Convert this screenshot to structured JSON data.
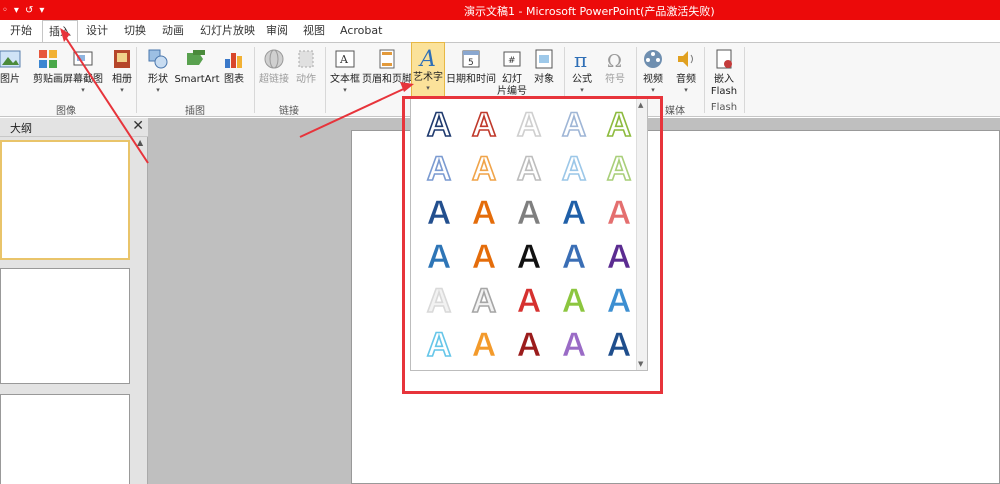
{
  "window": {
    "title": "演示文稿1 - Microsoft PowerPoint(产品激活失败)",
    "qat_items": [
      "◦",
      "▾",
      "↺",
      "▾"
    ]
  },
  "tabs": [
    "开始",
    "插入",
    "设计",
    "切换",
    "动画",
    "幻灯片放映",
    "审阅",
    "视图",
    "Acrobat"
  ],
  "active_tab": "插入",
  "ribbon": {
    "buttons": {
      "picture": "图片",
      "clipart": "剪贴画",
      "screenshot": "屏幕截图",
      "album": "相册",
      "shapes": "形状",
      "smartart": "SmartArt",
      "chart": "图表",
      "hyperlink": "超链接",
      "action": "动作",
      "textbox": "文本框",
      "header_footer": "页眉和页脚",
      "wordart": "艺术字",
      "datetime": "日期和时间",
      "slide_number_1": "幻灯",
      "slide_number_2": "片编号",
      "object": "对象",
      "equation": "公式",
      "symbol": "符号",
      "video": "视频",
      "audio": "音频",
      "flash_1": "嵌入",
      "flash_2": "Flash"
    },
    "groups": {
      "images": "图像",
      "illustrations": "插图",
      "links": "链接",
      "media": "媒体",
      "flash": "Flash"
    }
  },
  "left_pane": {
    "tab_label": "大纲",
    "close": "✕",
    "scroll_up": "▲"
  },
  "gallery": {
    "scroll_up": "▲",
    "scroll_down": "▼",
    "styles": [
      [
        "#1f3a6e",
        "#c0392b",
        "#cfcfcf",
        "#9fb6d6",
        "#8dbb3e"
      ],
      [
        "#7b9bd1",
        "#f0a44a",
        "#bdbdbd",
        "#9cc7e8",
        "#a9cf7a"
      ],
      [
        "#234f8e",
        "#e46c0a",
        "#7f7f7f",
        "#1f5fa8",
        "#e46f6f"
      ],
      [
        "#2e75b6",
        "#e46c0a",
        "#111111",
        "#3a6eb5",
        "#5b2c91"
      ],
      [
        "#d9d9d9",
        "#a6a6a6",
        "#d6312f",
        "#8cc63f",
        "#3d8fd1"
      ],
      [
        "#66c6e9",
        "#f39a2b",
        "#9b1c1c",
        "#9a6bc6",
        "#1f4e8c"
      ]
    ]
  },
  "colors": {
    "titlebar": "#ec0a0a",
    "highlight": "#fbe29a",
    "annotation": "#e7343b"
  }
}
